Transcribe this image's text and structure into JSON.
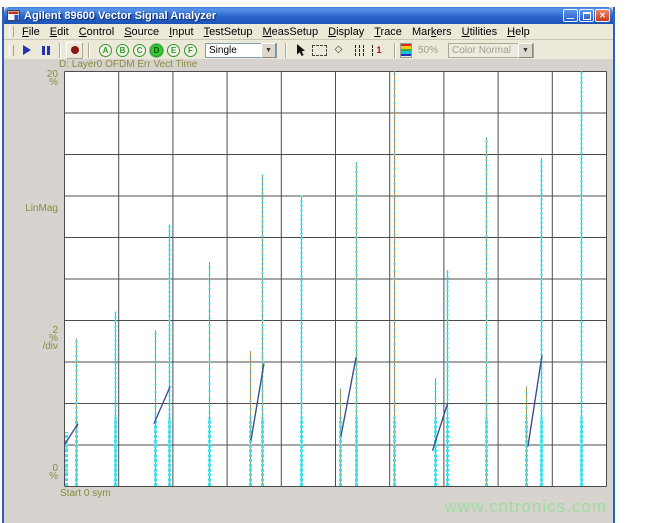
{
  "window": {
    "title": "Agilent 89600 Vector Signal Analyzer"
  },
  "menu": {
    "items": [
      {
        "label": "File",
        "u": 0
      },
      {
        "label": "Edit",
        "u": 0
      },
      {
        "label": "Control",
        "u": 0
      },
      {
        "label": "Source",
        "u": 0
      },
      {
        "label": "Input",
        "u": 0
      },
      {
        "label": "TestSetup",
        "u": 0
      },
      {
        "label": "MeasSetup",
        "u": 0
      },
      {
        "label": "Display",
        "u": 0
      },
      {
        "label": "Trace",
        "u": 0
      },
      {
        "label": "Markers",
        "u": 3
      },
      {
        "label": "Utilities",
        "u": 0
      },
      {
        "label": "Help",
        "u": 0
      }
    ]
  },
  "toolbar": {
    "trace_buttons": [
      {
        "label": "A",
        "selected": false
      },
      {
        "label": "B",
        "selected": false
      },
      {
        "label": "C",
        "selected": false
      },
      {
        "label": "D",
        "selected": true
      },
      {
        "label": "E",
        "selected": false
      },
      {
        "label": "F",
        "selected": false
      }
    ],
    "measurement_mode": "Single",
    "zoom_level": "50%",
    "color_mode": "Color Normal"
  },
  "watermark": "www.cntronics.com",
  "chart_data": {
    "type": "scatter",
    "title": "D: Layer0 OFDM Err Vect Time",
    "ylabel": "LinMag",
    "xlabel": "sym",
    "y_top_label": {
      "value": "20",
      "unit": "%"
    },
    "y_bottom_label": {
      "value": "0",
      "unit": "%"
    },
    "y_per_div": {
      "value": "2",
      "unit": "%",
      "suffix": "/div"
    },
    "x_start_label": "Start 0 sym",
    "ylim": [
      0,
      20
    ],
    "grid_divisions": {
      "x": 10,
      "y": 10
    },
    "colors": {
      "trace_olive": "#a59148",
      "symbol_cyan": "#3fe2ec",
      "segment_blue": "#3d4f93",
      "grid": "#4c4c4c",
      "label_olive": "#8a8a3d"
    },
    "spikes": [
      {
        "x_frac": 0.003,
        "top_pct": 2.6,
        "density": "sparse"
      },
      {
        "x_frac": 0.023,
        "top_pct": 7.1,
        "density": "dense"
      },
      {
        "x_frac": 0.095,
        "top_pct": 8.4,
        "density": "dense"
      },
      {
        "x_frac": 0.168,
        "top_pct": 7.5,
        "density": "medium"
      },
      {
        "x_frac": 0.193,
        "top_pct": 12.6,
        "density": "dense"
      },
      {
        "x_frac": 0.267,
        "top_pct": 10.8,
        "density": "medium"
      },
      {
        "x_frac": 0.343,
        "top_pct": 6.5,
        "density": "medium"
      },
      {
        "x_frac": 0.365,
        "top_pct": 15.0,
        "density": "dense"
      },
      {
        "x_frac": 0.438,
        "top_pct": 14.0,
        "density": "dense"
      },
      {
        "x_frac": 0.51,
        "top_pct": 4.7,
        "density": "medium"
      },
      {
        "x_frac": 0.538,
        "top_pct": 15.6,
        "density": "dense"
      },
      {
        "x_frac": 0.608,
        "top_pct": 20.0,
        "density": "medium"
      },
      {
        "x_frac": 0.684,
        "top_pct": 5.2,
        "density": "medium"
      },
      {
        "x_frac": 0.707,
        "top_pct": 10.4,
        "density": "dense"
      },
      {
        "x_frac": 0.778,
        "top_pct": 16.8,
        "density": "dense"
      },
      {
        "x_frac": 0.853,
        "top_pct": 4.8,
        "density": "medium"
      },
      {
        "x_frac": 0.88,
        "top_pct": 15.8,
        "density": "dense"
      },
      {
        "x_frac": 0.953,
        "top_pct": 20.0,
        "density": "dense"
      }
    ],
    "diagonals": [
      {
        "x1": 0.0,
        "y1": 2.0,
        "x2": 0.025,
        "y2": 3.0
      },
      {
        "x1": 0.165,
        "y1": 3.0,
        "x2": 0.195,
        "y2": 4.8
      },
      {
        "x1": 0.344,
        "y1": 2.2,
        "x2": 0.368,
        "y2": 5.9
      },
      {
        "x1": 0.51,
        "y1": 2.4,
        "x2": 0.538,
        "y2": 6.2
      },
      {
        "x1": 0.679,
        "y1": 1.7,
        "x2": 0.707,
        "y2": 4.0
      },
      {
        "x1": 0.855,
        "y1": 1.9,
        "x2": 0.881,
        "y2": 6.3
      }
    ]
  }
}
